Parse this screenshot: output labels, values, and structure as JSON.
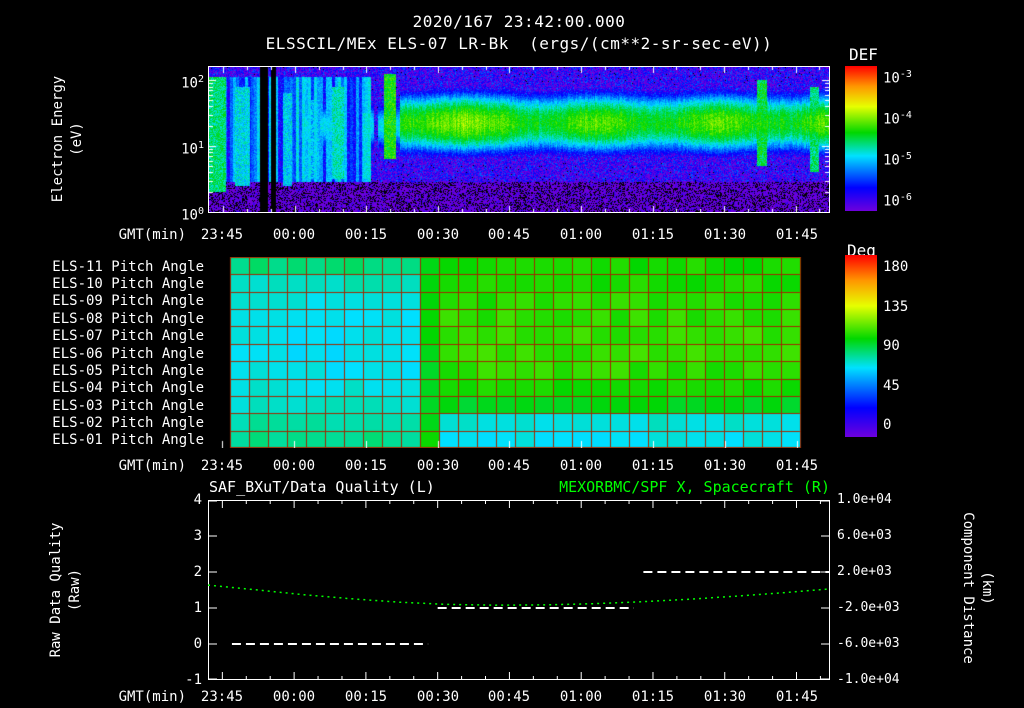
{
  "colors": {
    "background": "#000000",
    "foreground": "#ffffff",
    "accent_green": "#00ff00",
    "grid_red": "#a02800"
  },
  "time_axis": {
    "label": "GMT(min)",
    "start_time": "23:42",
    "tick_labels": [
      "23:45",
      "00:00",
      "00:15",
      "00:30",
      "00:45",
      "01:00",
      "01:15",
      "01:30",
      "01:45"
    ],
    "tick_minutes": [
      3,
      18,
      33,
      48,
      63,
      78,
      93,
      108,
      123
    ],
    "range_minutes": [
      0,
      130
    ]
  },
  "chart_data": [
    {
      "id": "electron-energy-spectrogram",
      "type": "heatmap",
      "title": "2020/167 23:42:00.000",
      "subtitle": "ELSSCIL/MEx ELS-07 LR-Bk  (ergs/(cm**2-sr-sec-eV))",
      "xlabel": "GMT(min)",
      "ylabel": "Electron Energy",
      "ylabel_units": "(eV)",
      "y_scale": "log",
      "y_range_log10_ev": [
        0,
        2.2
      ],
      "y_ticks": [
        {
          "base": "10",
          "exp": "2"
        },
        {
          "base": "10",
          "exp": "1"
        },
        {
          "base": "10",
          "exp": "0"
        }
      ],
      "colorbar": {
        "title": "DEF",
        "units": "ergs/(cm**2-sr-sec-eV)",
        "scale": "log",
        "range_log10": [
          -6,
          -3
        ],
        "ticks": [
          {
            "base": "10",
            "exp": "-3"
          },
          {
            "base": "10",
            "exp": "-4"
          },
          {
            "base": "10",
            "exp": "-5"
          },
          {
            "base": "10",
            "exp": "-6"
          }
        ]
      },
      "background_log10_flux": -5.75,
      "band": {
        "description": "enhanced electron flux band near 20-30 eV",
        "center_log10_ev": 1.35,
        "sigma_log10": 0.3,
        "onset_minute": 40,
        "peak_log10_flux": -4.3,
        "patchy_pre_onset_log10_flux": -4.85
      },
      "events": [
        {
          "minute": 1.5,
          "width_min": 4.0,
          "log10_flux": -4.6,
          "log10_ev_lo": 0.3,
          "log10_ev_hi": 2.05
        },
        {
          "minute": 7.0,
          "width_min": 3.0,
          "log10_flux": -4.85,
          "log10_ev_lo": 0.4,
          "log10_ev_hi": 1.9
        },
        {
          "minute": 11.5,
          "width_min": 1.6,
          "kind": "gap",
          "log10_flux": -7,
          "log10_ev_lo": 0,
          "log10_ev_hi": 2.2
        },
        {
          "minute": 13.5,
          "width_min": 1.2,
          "kind": "gap",
          "log10_flux": -7,
          "log10_ev_lo": 0,
          "log10_ev_hi": 2.2
        },
        {
          "minute": 16.5,
          "width_min": 2.0,
          "log10_flux": -4.9,
          "log10_ev_lo": 0.4,
          "log10_ev_hi": 1.8
        },
        {
          "minute": 22.0,
          "width_min": 2.0,
          "log10_flux": -5.0,
          "log10_ev_lo": 0.5,
          "log10_ev_hi": 1.7
        },
        {
          "minute": 27.0,
          "width_min": 2.5,
          "log10_flux": -4.75,
          "log10_ev_lo": 0.5,
          "log10_ev_hi": 1.9
        },
        {
          "minute": 33.0,
          "width_min": 1.6,
          "log10_flux": -4.9,
          "log10_ev_lo": 0.5,
          "log10_ev_hi": 1.5
        },
        {
          "minute": 38.0,
          "width_min": 2.6,
          "log10_flux": -4.35,
          "log10_ev_lo": 0.8,
          "log10_ev_hi": 2.1
        },
        {
          "minute": 116.0,
          "width_min": 2.2,
          "log10_flux": -4.5,
          "log10_ev_lo": 0.7,
          "log10_ev_hi": 2.0
        },
        {
          "minute": 127.0,
          "width_min": 2.0,
          "log10_flux": -4.6,
          "log10_ev_lo": 0.6,
          "log10_ev_hi": 1.9
        }
      ]
    },
    {
      "id": "pitch-angle-panels",
      "type": "heatmap",
      "xlabel": "GMT(min)",
      "x_start_minute": 4.6,
      "x_end_minute": 123.7,
      "columns": 30,
      "transition_window_minutes": [
        44,
        48
      ],
      "colorbar": {
        "title": "Deg",
        "range": [
          0,
          180
        ],
        "tick_values": [
          180,
          135,
          90,
          45,
          0
        ]
      },
      "rows": [
        {
          "name": "ELS-11 Pitch Angle",
          "left_deg": 84,
          "transition_deg": 97,
          "right_deg": 100
        },
        {
          "name": "ELS-10 Pitch Angle",
          "left_deg": 76,
          "transition_deg": 96,
          "right_deg": 101
        },
        {
          "name": "ELS-09 Pitch Angle",
          "left_deg": 72,
          "transition_deg": 96,
          "right_deg": 102
        },
        {
          "name": "ELS-08 Pitch Angle",
          "left_deg": 70,
          "transition_deg": 95,
          "right_deg": 103
        },
        {
          "name": "ELS-07 Pitch Angle",
          "left_deg": 70,
          "transition_deg": 95,
          "right_deg": 104
        },
        {
          "name": "ELS-06 Pitch Angle",
          "left_deg": 69,
          "transition_deg": 95,
          "right_deg": 104
        },
        {
          "name": "ELS-05 Pitch Angle",
          "left_deg": 70,
          "transition_deg": 95,
          "right_deg": 103
        },
        {
          "name": "ELS-04 Pitch Angle",
          "left_deg": 72,
          "transition_deg": 96,
          "right_deg": 100
        },
        {
          "name": "ELS-03 Pitch Angle",
          "left_deg": 74,
          "transition_deg": 96,
          "right_deg": 94
        },
        {
          "name": "ELS-02 Pitch Angle",
          "left_deg": 78,
          "transition_deg": 97,
          "right_deg": 73
        },
        {
          "name": "ELS-01 Pitch Angle",
          "left_deg": 82,
          "transition_deg": 98,
          "right_deg": 70
        }
      ]
    },
    {
      "id": "quality-and-distance",
      "type": "line",
      "title_left": "SAF_BXuT/Data Quality (L)",
      "title_right": "MEXORBMC/SPF X, Spacecraft (R)",
      "xlabel": "GMT(min)",
      "left_axis": {
        "label": "Raw Data Quality",
        "label_units": "(Raw)",
        "range": [
          -1,
          4
        ],
        "tick_values": [
          "4",
          "3",
          "2",
          "1",
          "0",
          "-1"
        ]
      },
      "right_axis": {
        "label": "Component Distance",
        "label_units": "(km)",
        "range_km": [
          -10000,
          10000
        ],
        "tick_values": [
          "1.0e+04",
          "6.0e+03",
          "2.0e+03",
          "-2.0e+03",
          "-6.0e+03",
          "-1.0e+04"
        ]
      },
      "series": [
        {
          "name": "SAF_BXuT/Data Quality",
          "axis": "left",
          "color": "#ffffff",
          "style": "dashed",
          "steps": [
            {
              "from_min": 5,
              "to_min": 46,
              "value": 0
            },
            {
              "from_min": 48,
              "to_min": 89,
              "value": 1
            },
            {
              "from_min": 91,
              "to_min": 130,
              "value": 2
            }
          ]
        },
        {
          "name": "MEXORBMC/SPF X Spacecraft",
          "axis": "right",
          "color": "#00ff00",
          "style": "dotted",
          "minutes": [
            0,
            10,
            20,
            30,
            40,
            50,
            60,
            70,
            80,
            90,
            100,
            110,
            120,
            130
          ],
          "km": [
            550,
            20,
            -520,
            -980,
            -1350,
            -1600,
            -1690,
            -1660,
            -1530,
            -1320,
            -1040,
            -700,
            -310,
            120
          ]
        }
      ]
    }
  ]
}
